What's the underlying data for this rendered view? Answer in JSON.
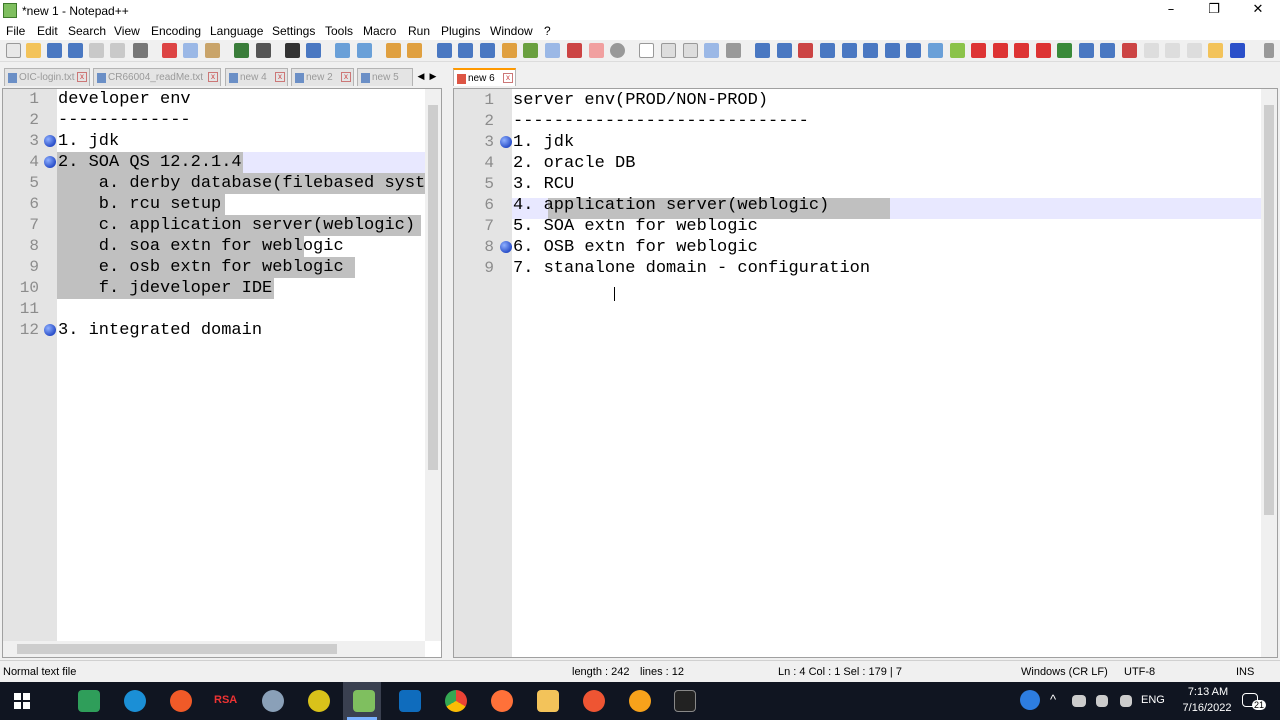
{
  "window": {
    "title": "*new 1 - Notepad++",
    "minimize": "–",
    "maximize": "❐",
    "close": "✕"
  },
  "menu": [
    "File",
    "Edit",
    "Search",
    "View",
    "Encoding",
    "Language",
    "Settings",
    "Tools",
    "Macro",
    "Run",
    "Plugins",
    "Window",
    "?"
  ],
  "left_tabs": [
    "OIC-login.txt",
    "CR66004_readMe.txt",
    "new 4",
    "new 2",
    "new 5"
  ],
  "right_tabs": [
    "new 6"
  ],
  "left_editor": {
    "lines": [
      {
        "n": "1",
        "text": "developer env"
      },
      {
        "n": "2",
        "text": "-------------"
      },
      {
        "n": "3",
        "text": "1. jdk"
      },
      {
        "n": "4",
        "text": "2. SOA QS 12.2.1.4"
      },
      {
        "n": "5",
        "text": "    a. derby database(filebased syst"
      },
      {
        "n": "6",
        "text": "    b. rcu setup"
      },
      {
        "n": "7",
        "text": "    c. application server(weblogic)"
      },
      {
        "n": "8",
        "text": "    d. soa extn for weblogic"
      },
      {
        "n": "9",
        "text": "    e. osb extn for weblogic"
      },
      {
        "n": "10",
        "text": "    f. jdeveloper IDE"
      },
      {
        "n": "11",
        "text": ""
      },
      {
        "n": "12",
        "text": "3. integrated domain"
      }
    ]
  },
  "right_editor": {
    "lines": [
      {
        "n": "1",
        "text": "server env(PROD/NON-PROD)"
      },
      {
        "n": "2",
        "text": "-----------------------------"
      },
      {
        "n": "3",
        "text": "1. jdk"
      },
      {
        "n": "4",
        "text": "2. oracle DB"
      },
      {
        "n": "5",
        "text": "3. RCU"
      },
      {
        "n": "6",
        "text": "4. application server(weblogic)"
      },
      {
        "n": "7",
        "text": "5. SOA extn for weblogic"
      },
      {
        "n": "8",
        "text": "6. OSB extn for weblogic"
      },
      {
        "n": "9",
        "text": "7. stanalone domain - configuration"
      }
    ]
  },
  "status": {
    "filetype": "Normal text file",
    "length": "length : 242",
    "lines": "lines : 12",
    "position": "Ln : 4    Col : 1    Sel : 179 | 7",
    "eol": "Windows (CR LF)",
    "encoding": "UTF-8",
    "mode": "INS"
  },
  "taskbar": {
    "time": "7:13 AM",
    "date": "7/16/2022",
    "lang": "ENG",
    "notif_count": "21",
    "rsa": "RSA"
  }
}
